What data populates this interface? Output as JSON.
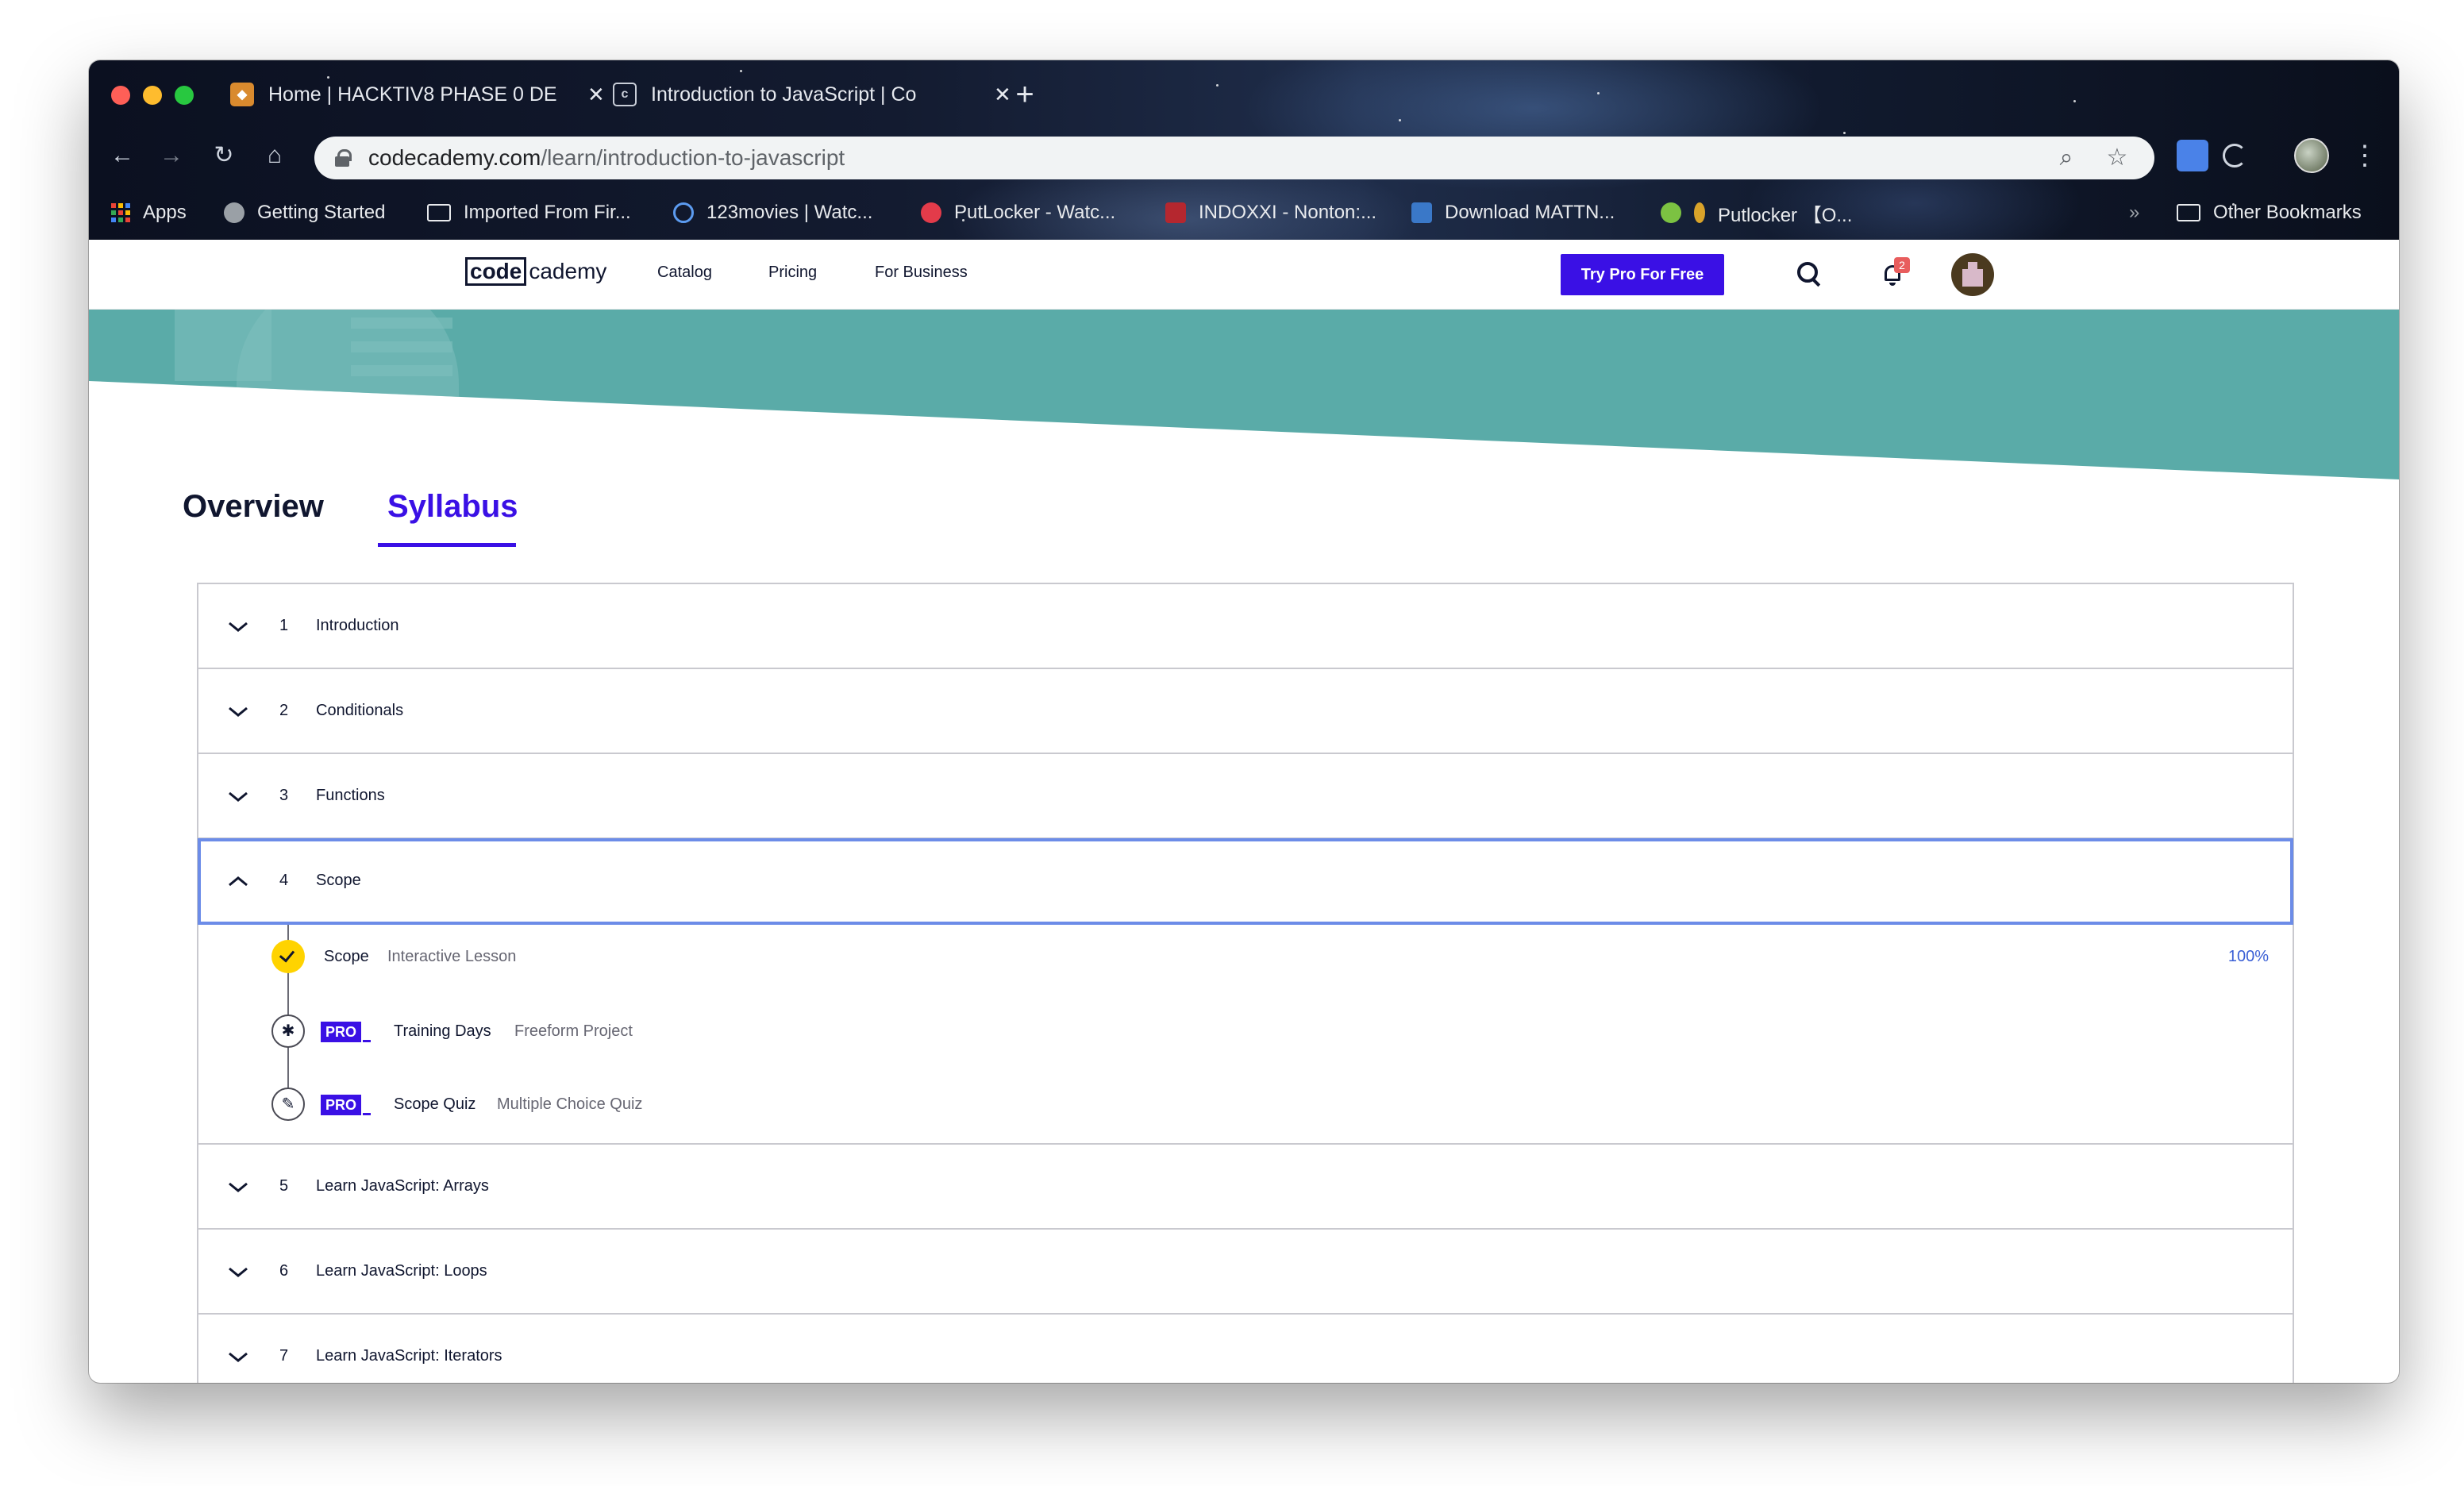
{
  "browser": {
    "tabs": [
      {
        "title": "Home | HACKTIV8 PHASE 0 DE",
        "favicon": "hacktiv8-fox-icon"
      },
      {
        "title": "Introduction to JavaScript | Co",
        "favicon": "codecademy-icon"
      }
    ],
    "url_host": "codecademy.com",
    "url_path": "/learn/introduction-to-javascript",
    "bookmarks": [
      {
        "label": "Apps",
        "icon": "apps-grid-icon"
      },
      {
        "label": "Getting Started",
        "icon": "globe-icon"
      },
      {
        "label": "Imported From Fir...",
        "icon": "folder-icon"
      },
      {
        "label": "123movies | Watc...",
        "icon": "play-circle-icon"
      },
      {
        "label": "PutLocker - Watc...",
        "icon": "film-reel-icon"
      },
      {
        "label": "INDOXXI - Nonton:...",
        "icon": "indoxxi-icon"
      },
      {
        "label": "Download MATTN...",
        "icon": "mp3-icon"
      },
      {
        "label": "Putlocker 【O...",
        "icon": "putlocker-icon"
      }
    ],
    "overflow": "»",
    "other_bookmarks": "Other Bookmarks"
  },
  "site": {
    "logo_code": "code",
    "logo_rest": "cademy",
    "nav": [
      "Catalog",
      "Pricing",
      "For Business"
    ],
    "cta": "Try Pro For Free",
    "notification_count": "2"
  },
  "page_tabs": {
    "overview": "Overview",
    "syllabus": "Syllabus"
  },
  "modules_before": [
    {
      "num": "1",
      "title": "Introduction"
    },
    {
      "num": "2",
      "title": "Conditionals"
    },
    {
      "num": "3",
      "title": "Functions"
    }
  ],
  "open_module": {
    "num": "4",
    "title": "Scope"
  },
  "lessons": [
    {
      "name": "Scope",
      "type": "Interactive Lesson",
      "progress": "100%",
      "pro": false,
      "status": "complete"
    },
    {
      "name": "Training Days",
      "type": "Freeform Project",
      "pro": true,
      "pro_label": "PRO",
      "icon": "puzzle-icon"
    },
    {
      "name": "Scope Quiz",
      "type": "Multiple Choice Quiz",
      "pro": true,
      "pro_label": "PRO",
      "icon": "pencil-icon"
    }
  ],
  "modules_after": [
    {
      "num": "5",
      "title": "Learn JavaScript: Arrays"
    },
    {
      "num": "6",
      "title": "Learn JavaScript: Loops"
    },
    {
      "num": "7",
      "title": "Learn JavaScript: Iterators"
    }
  ],
  "colors": {
    "brand": "#3a10e5",
    "teal": "#5aaba8",
    "badge": "#e85d5d",
    "complete": "#ffd300"
  }
}
